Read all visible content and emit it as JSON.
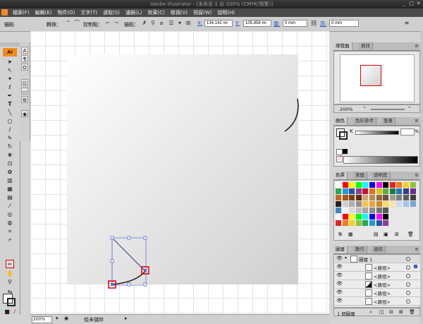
{
  "window": {
    "title": "Adobe Illustrator - [未命名-1 @ 200% (CMYK/預覽)]",
    "controls": [
      "_",
      "□",
      "✕"
    ]
  },
  "menu": {
    "items": [
      "檔案(F)",
      "編輯(E)",
      "物件(O)",
      "文字(T)",
      "選取(S)",
      "濾鏡(L)",
      "效果(C)",
      "檢視(V)",
      "視窗(W)",
      "說明(H)"
    ]
  },
  "control_bar": {
    "anchor_label": "錨點",
    "convert_label": "轉換：",
    "handles_label": "控制點：",
    "anchors_label": "錨點：",
    "x_label": "X:",
    "x_value": "134.142 mi",
    "y_label": "Y:",
    "y_value": "105.858 mi",
    "w_label": "寬:",
    "w_value": "0 mm",
    "h_label": "高:",
    "h_value": "0 mm"
  },
  "toolbar": {
    "logo": "Ai"
  },
  "status_bar": {
    "zoom": "200%",
    "status": "從未儲存"
  },
  "navigator": {
    "tabs": [
      "導覽器",
      "資訊"
    ],
    "zoom": "200%"
  },
  "color_panel": {
    "tabs": [
      "顏色",
      "色彩參考",
      "筆畫"
    ],
    "channel_label": "K",
    "percent_sign": "%"
  },
  "swatches_panel": {
    "tabs": [
      "色票",
      "漸層",
      "透明度"
    ]
  },
  "layers_panel": {
    "tabs": [
      "圖層",
      "動作",
      "連結"
    ],
    "layer_name": "圖層 1",
    "rows": [
      "<路徑>",
      "<路徑>",
      "<路徑>",
      "<路徑>",
      "<路徑>"
    ],
    "count": "1 個圖層"
  },
  "colors": {
    "accent": "#f08a1f",
    "selection": "#e00000",
    "path": "#2b3d8f"
  }
}
